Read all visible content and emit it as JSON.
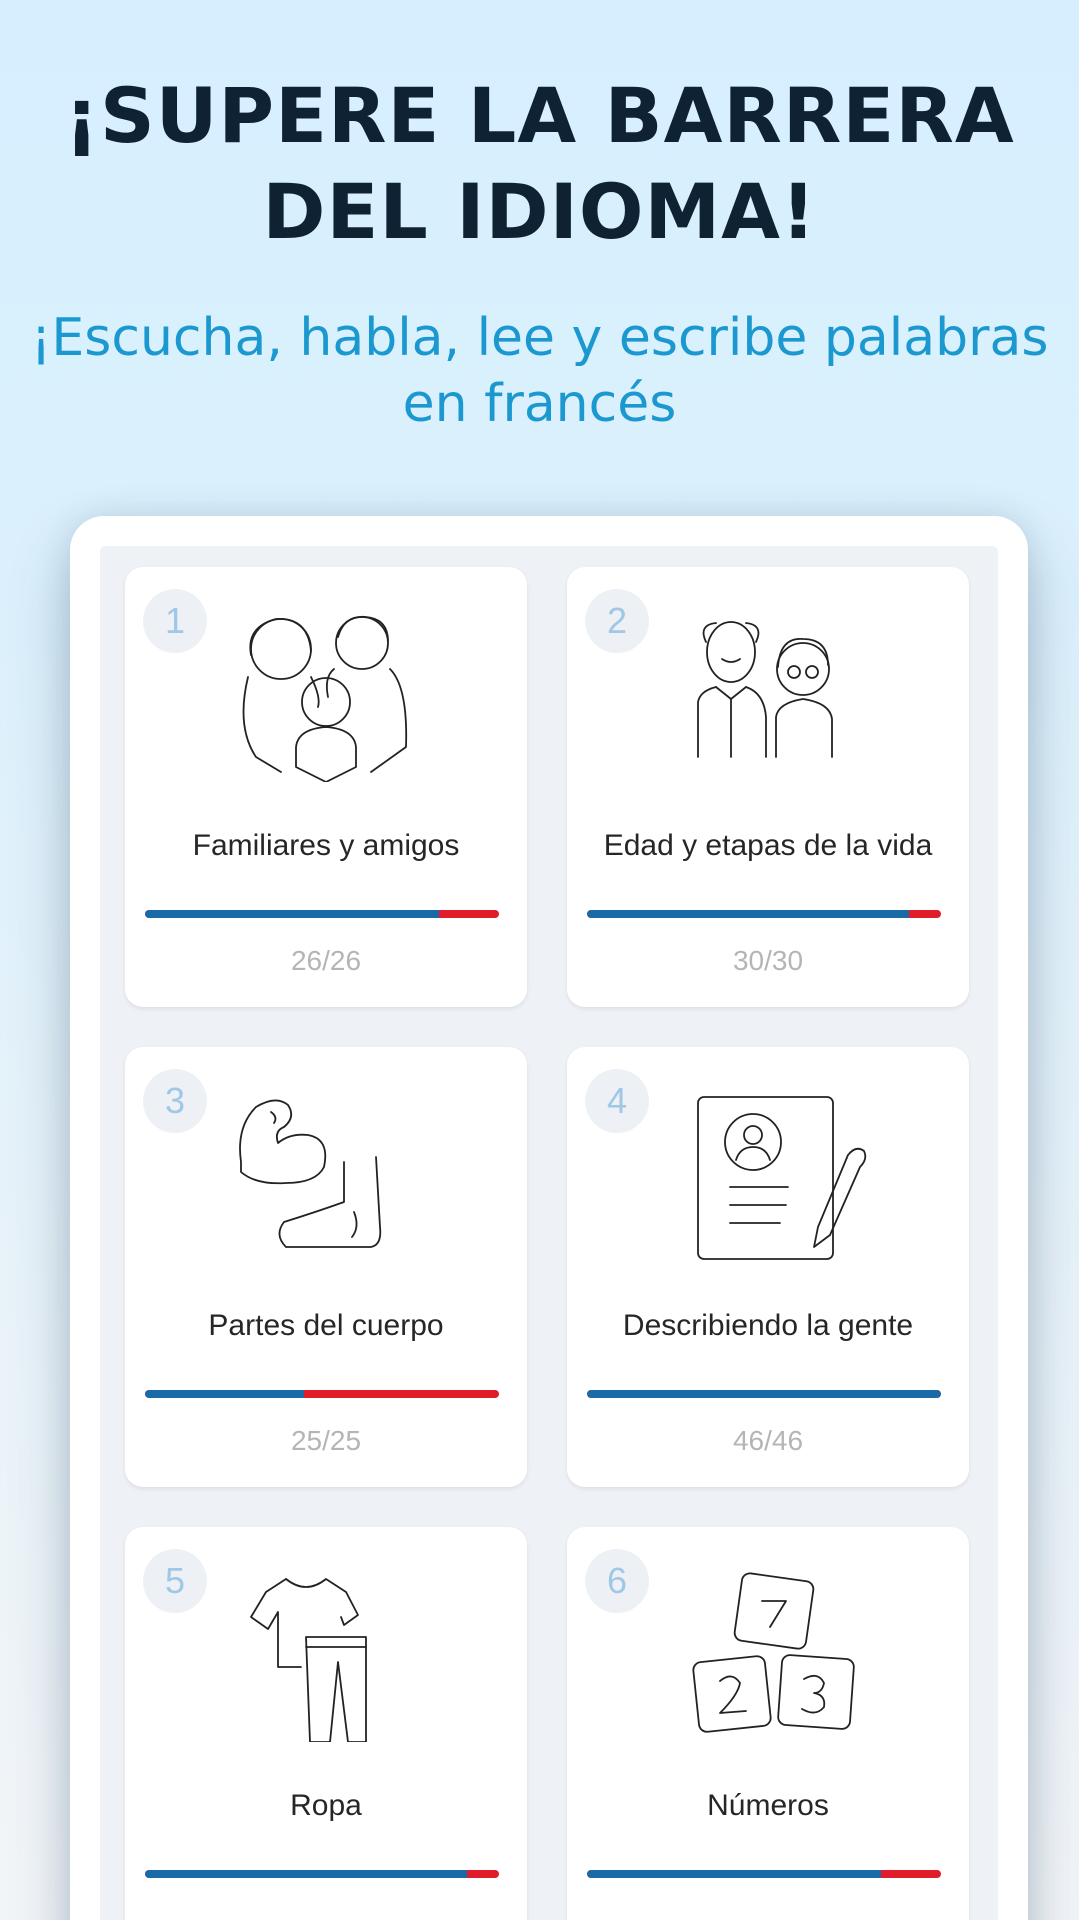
{
  "headline": "¡SUPERE LA BARRERA DEL IDIOMA!",
  "subheadline": "¡Escucha, habla, lee y escribe palabras en francés",
  "colors": {
    "progress_done": "#1a6aa8",
    "progress_remaining": "#e01c2a",
    "subheadline": "#1b98cf",
    "headline": "#0f2233"
  },
  "topics": [
    {
      "number": "1",
      "title": "Familiares y amigos",
      "count": "26/26",
      "progress": 0.83,
      "icon": "family-icon"
    },
    {
      "number": "2",
      "title": "Edad y etapas de la vida",
      "count": "30/30",
      "progress": 0.91,
      "icon": "elderly-couple-icon"
    },
    {
      "number": "3",
      "title": "Partes del cuerpo",
      "count": "25/25",
      "progress": 0.45,
      "icon": "body-parts-icon"
    },
    {
      "number": "4",
      "title": "Describiendo la gente",
      "count": "46/46",
      "progress": 1.0,
      "icon": "profile-document-icon"
    },
    {
      "number": "5",
      "title": "Ropa",
      "count": "",
      "progress": 0.91,
      "icon": "clothes-icon"
    },
    {
      "number": "6",
      "title": "Números",
      "count": "",
      "progress": 0.83,
      "icon": "number-blocks-icon"
    }
  ]
}
